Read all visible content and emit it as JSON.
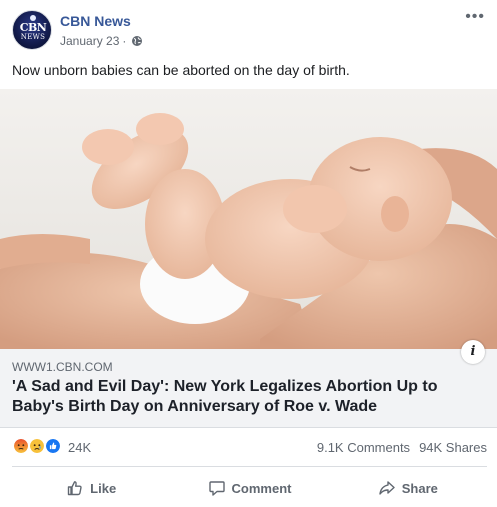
{
  "post": {
    "page_name": "CBN News",
    "date": "January 23",
    "separator": "·",
    "privacy_icon": "globe-icon",
    "more_icon": "more-options-icon",
    "caption": "Now unborn babies can be aborted on the day of birth."
  },
  "avatar": {
    "logo_top": "CBN",
    "logo_bottom": "NEWS"
  },
  "link": {
    "domain": "WWW1.CBN.COM",
    "title": "'A Sad and Evil Day': New York Legalizes Abortion Up to Baby's Birth Day on Anniversary of Roe v. Wade"
  },
  "stats": {
    "reaction_icons": [
      "angry-icon",
      "sad-icon",
      "like-icon"
    ],
    "reaction_count": "24K",
    "comments": "9.1K Comments",
    "shares": "94K Shares"
  },
  "actions": {
    "like": "Like",
    "comment": "Comment",
    "share": "Share"
  },
  "colors": {
    "page_name": "#385898",
    "meta": "#606770",
    "link_bg": "#f2f3f5",
    "like_blue": "#1877f2",
    "angry_orange": "#f07a2c",
    "sad_yellow": "#f7c13b"
  }
}
